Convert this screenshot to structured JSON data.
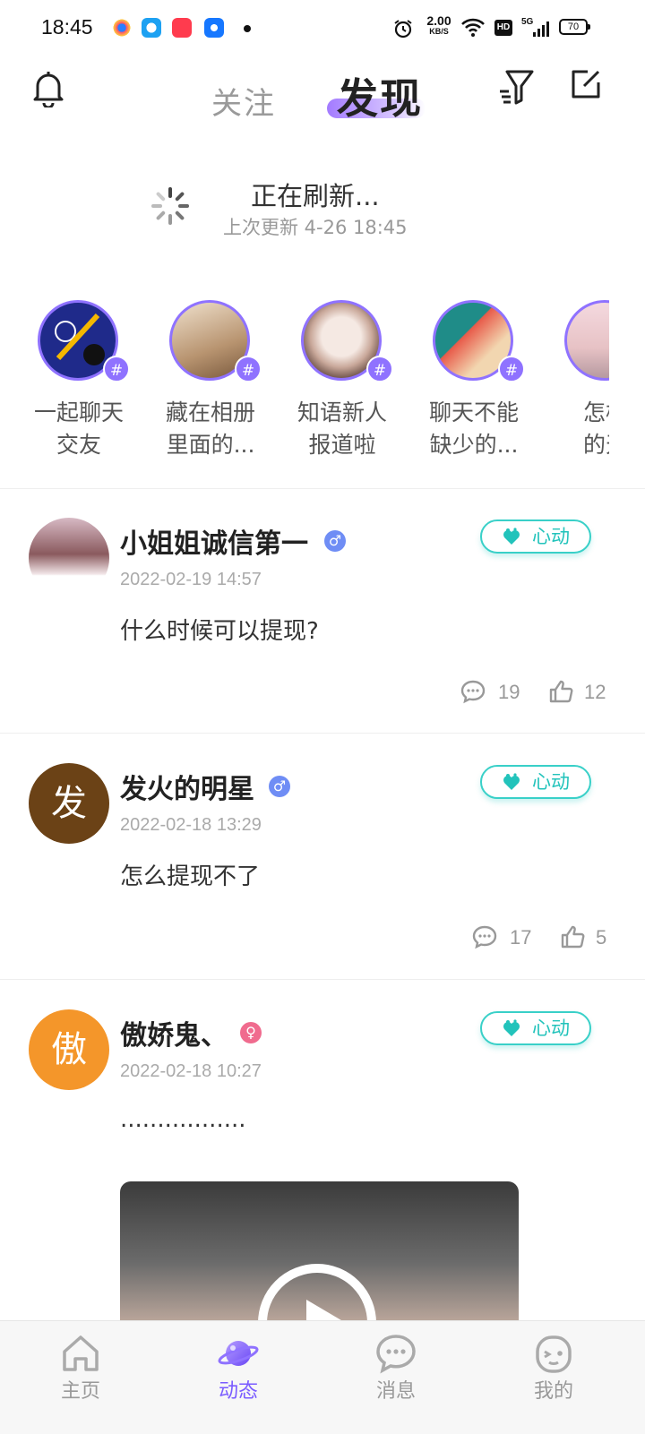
{
  "status_bar": {
    "time": "18:45",
    "network_speed_value": "2.00",
    "network_speed_unit": "KB/S",
    "hd_label": "HD",
    "signal_label": "5G",
    "battery": "70"
  },
  "header": {
    "tab_follow": "关注",
    "tab_discover": "发现",
    "accent": "#8f72ff"
  },
  "refresh": {
    "title": "正在刷新...",
    "subtitle": "上次更新 4-26 18:45"
  },
  "topics": [
    {
      "line1": "一起聊天",
      "line2": "交友",
      "badge": "#"
    },
    {
      "line1": "藏在相册",
      "line2": "里面的...",
      "badge": "#"
    },
    {
      "line1": "知语新人",
      "line2": "报道啦",
      "badge": "#"
    },
    {
      "line1": "聊天不能",
      "line2": "缺少的...",
      "badge": "#"
    },
    {
      "line1": "怎样",
      "line2": "的天",
      "badge": "#"
    }
  ],
  "posts": [
    {
      "name": "小姐姐诚信第一",
      "gender": "♂",
      "time": "2022-02-19 14:57",
      "text": "什么时候可以提现?",
      "like_label": "心动",
      "comments": "19",
      "likes": "12"
    },
    {
      "name": "发火的明星",
      "avatar_char": "发",
      "gender": "♂",
      "time": "2022-02-18 13:29",
      "text": "怎么提现不了",
      "like_label": "心动",
      "comments": "17",
      "likes": "5"
    },
    {
      "name": "傲娇鬼、",
      "avatar_char": "傲",
      "gender": "♀",
      "time": "2022-02-18 10:27",
      "text": ".................",
      "like_label": "心动"
    }
  ],
  "bottom_nav": [
    {
      "label": "主页",
      "icon": "home-icon"
    },
    {
      "label": "动态",
      "icon": "planet-icon",
      "active": true
    },
    {
      "label": "消息",
      "icon": "message-icon"
    },
    {
      "label": "我的",
      "icon": "profile-face-icon"
    }
  ]
}
